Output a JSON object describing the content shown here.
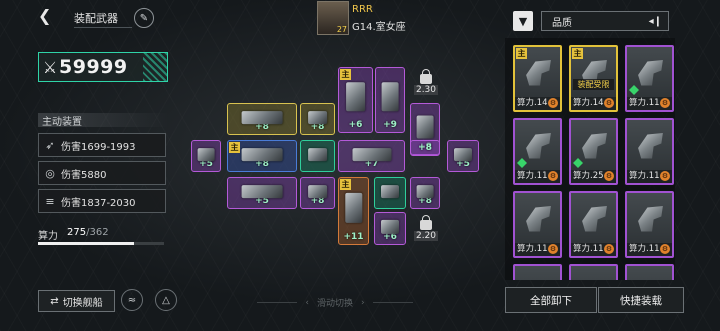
{
  "header": {
    "back_icon": "back-arrow-icon",
    "title": "装配武器",
    "title_icon": "wrench-icon",
    "player_name": "RRR",
    "player_level": "27",
    "player_location": "G14.室女座"
  },
  "power": {
    "icon": "crossed-swords-icon",
    "value": "59999"
  },
  "weapon_panel": {
    "section_label": "主动装置",
    "stats": [
      {
        "icon": "missile-icon",
        "label": "伤害1699-1993"
      },
      {
        "icon": "target-icon",
        "label": "伤害5880"
      },
      {
        "icon": "multi-missile-icon",
        "label": "伤害1837-2030"
      }
    ],
    "compute_label": "算力",
    "compute_used": "275",
    "compute_max": "/362",
    "compute_fraction": 0.76
  },
  "ship_slots": {
    "main_tag": "主",
    "bonuses": [
      "+8",
      "+8",
      "+6",
      "+9",
      "+8",
      "+5",
      "+8",
      "+7",
      "+8",
      "+5",
      "+5",
      "+8",
      "+8",
      "+11",
      "+6"
    ],
    "locks": [
      {
        "level": "2.30"
      },
      {
        "level": "2.20"
      }
    ]
  },
  "right_panel": {
    "filter_icon": "filter-icon",
    "sort_label": "品质",
    "sort_icon": "sort-toggle-icon",
    "cards": [
      {
        "tier": "gold",
        "main": true,
        "label": "算力.14",
        "equipped": "",
        "rank": false
      },
      {
        "tier": "gold",
        "main": true,
        "label": "算力.14",
        "equipped": "装配受限",
        "rank": false
      },
      {
        "tier": "purple",
        "main": false,
        "label": "算力.11",
        "equipped": "",
        "rank": true
      },
      {
        "tier": "purple",
        "main": false,
        "label": "算力.11",
        "equipped": "",
        "rank": true
      },
      {
        "tier": "purple",
        "main": false,
        "label": "算力.25",
        "equipped": "",
        "rank": true
      },
      {
        "tier": "purple",
        "main": false,
        "label": "算力.11",
        "equipped": "",
        "rank": false
      },
      {
        "tier": "purple",
        "main": false,
        "label": "算力.11",
        "equipped": "",
        "rank": false
      },
      {
        "tier": "purple",
        "main": false,
        "label": "算力.11",
        "equipped": "",
        "rank": false
      },
      {
        "tier": "purple",
        "main": false,
        "label": "算力.11",
        "equipped": "",
        "rank": false
      }
    ],
    "unload_all": "全部卸下",
    "quick_equip": "快捷装载"
  },
  "footer": {
    "switch_ship": "切换舰船",
    "switch_icon": "swap-icon",
    "round_icons": [
      "formation-icon",
      "fleet-icon"
    ],
    "slide_hint": "滑动切换"
  }
}
